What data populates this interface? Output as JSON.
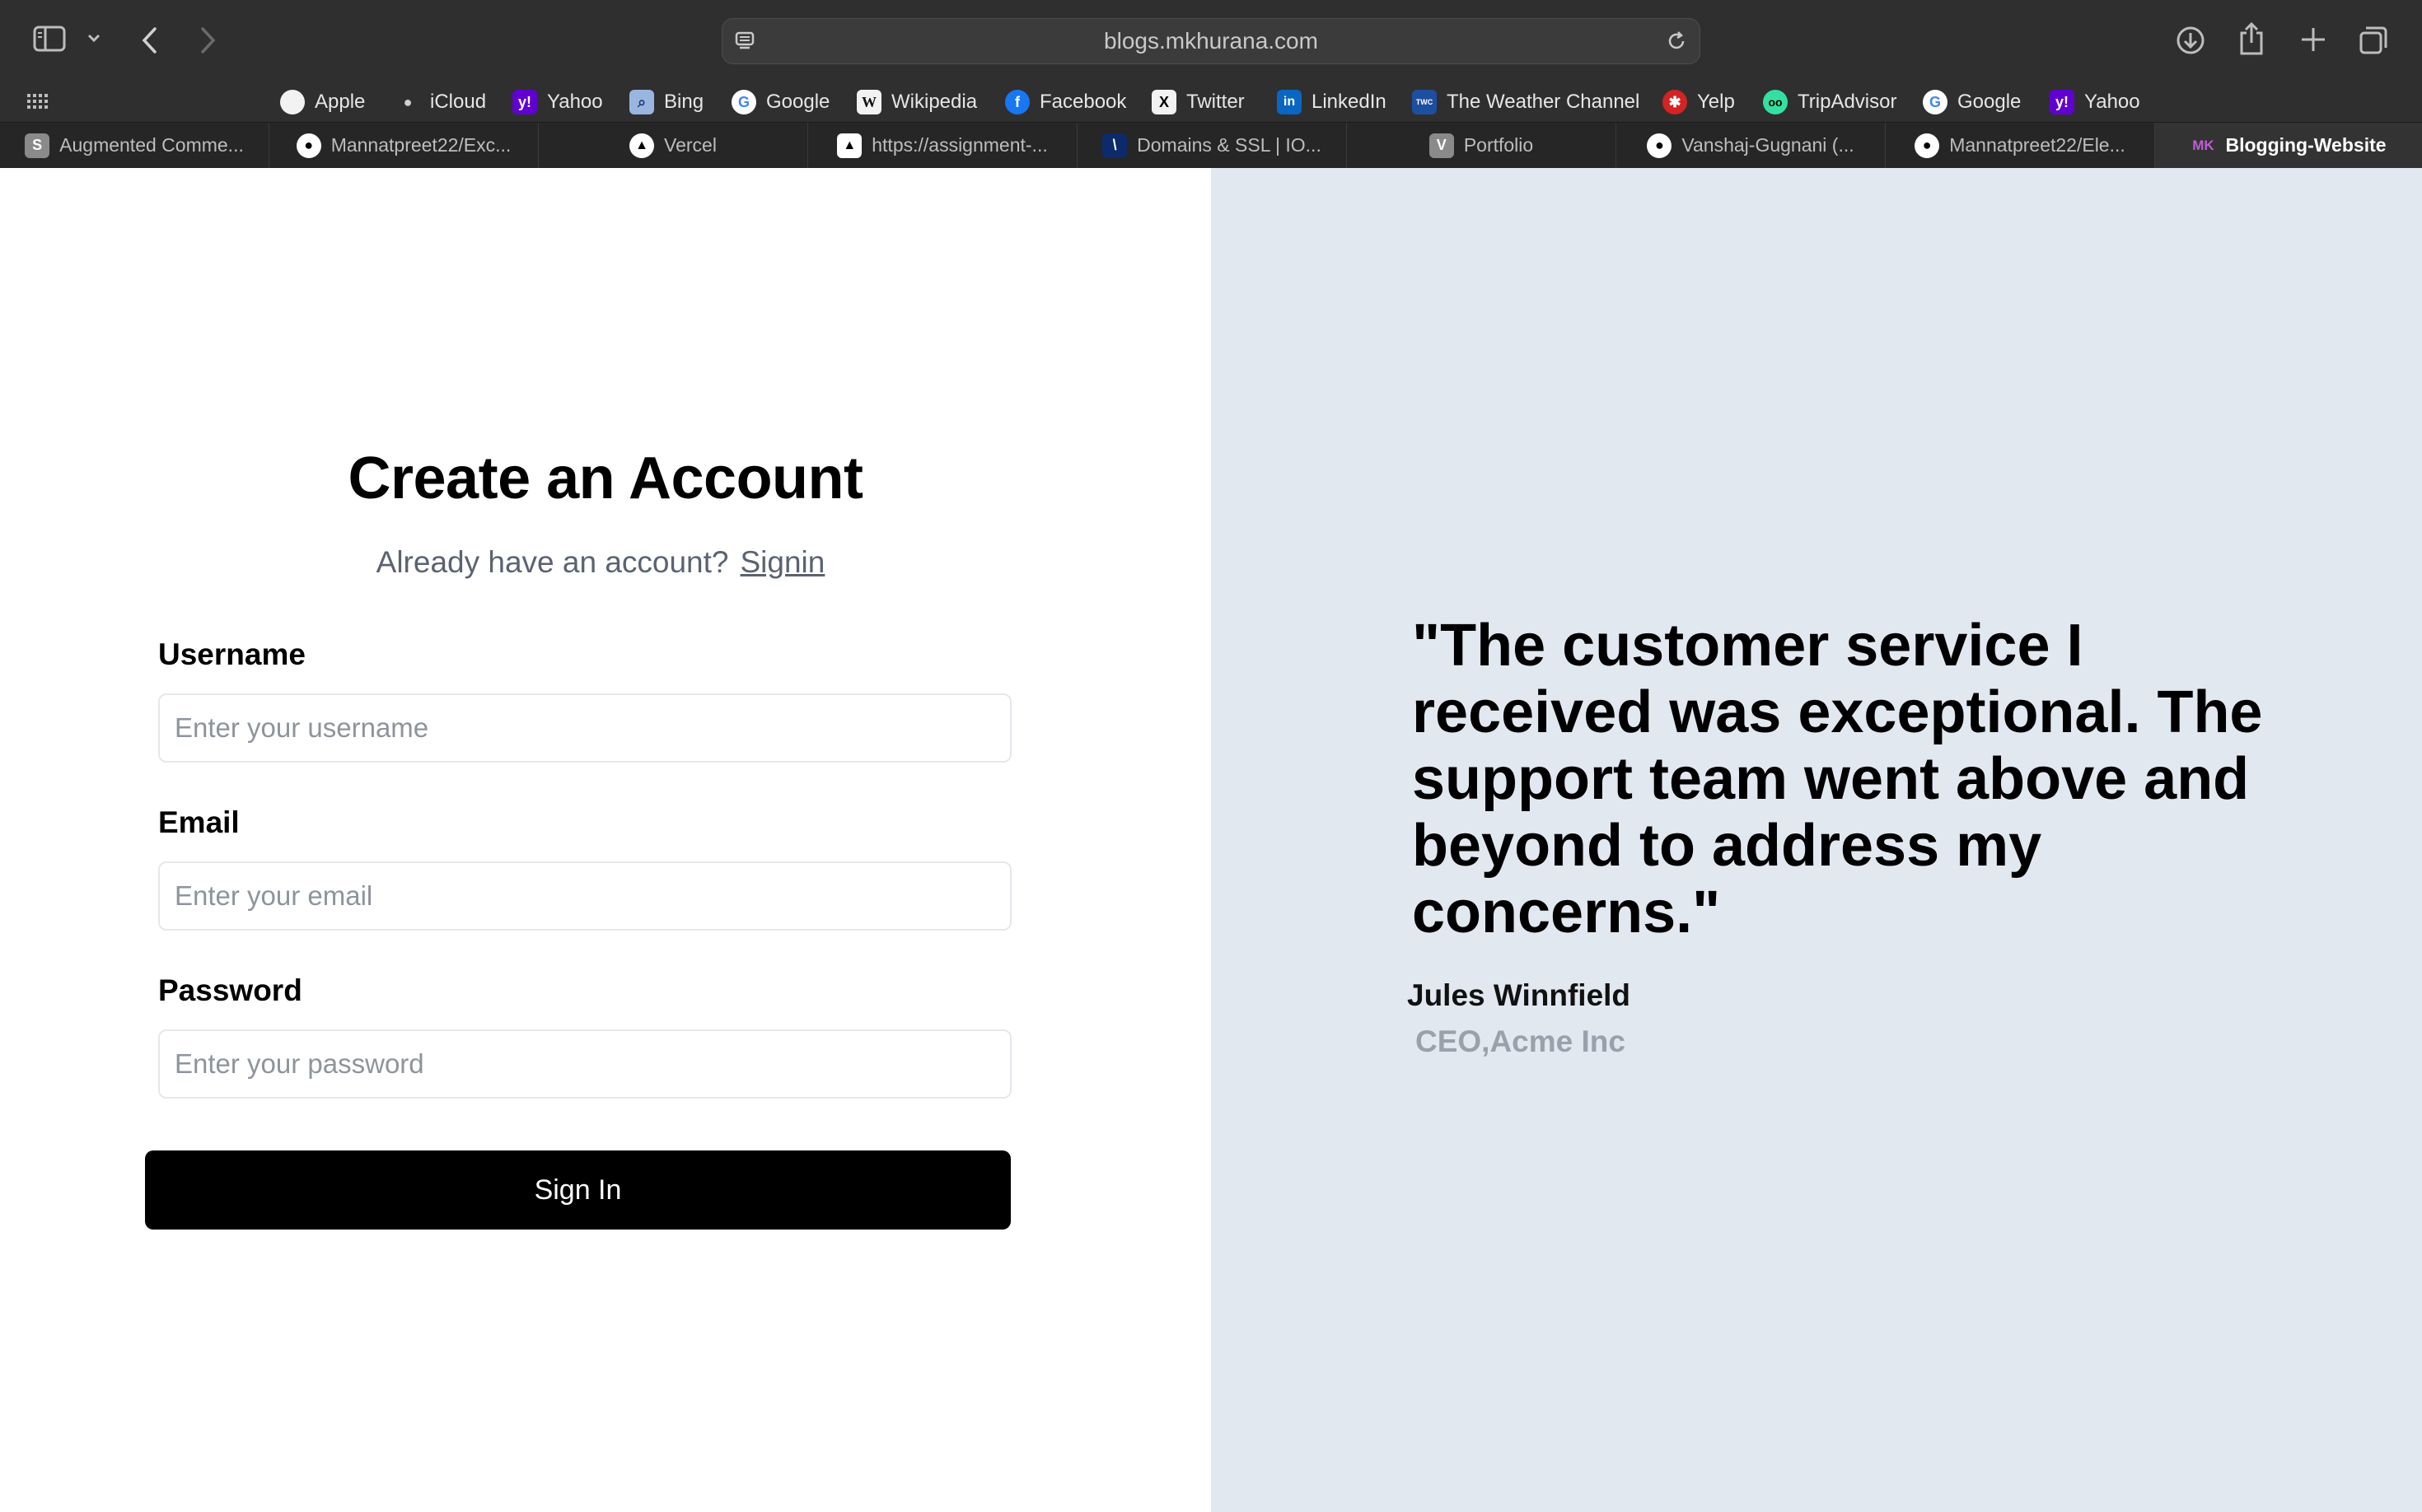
{
  "browser": {
    "url": "blogs.mkhurana.com",
    "favorites": [
      {
        "label": "Apple",
        "icon": "apple-icon"
      },
      {
        "label": "iCloud",
        "icon": "apple-icon"
      },
      {
        "label": "Yahoo",
        "icon": "yahoo-icon"
      },
      {
        "label": "Bing",
        "icon": "bing-icon"
      },
      {
        "label": "Google",
        "icon": "google-icon"
      },
      {
        "label": "Wikipedia",
        "icon": "wikipedia-icon"
      },
      {
        "label": "Facebook",
        "icon": "facebook-icon"
      },
      {
        "label": "Twitter",
        "icon": "x-icon"
      },
      {
        "label": "LinkedIn",
        "icon": "linkedin-icon"
      },
      {
        "label": "The Weather Channel",
        "icon": "weather-channel-icon"
      },
      {
        "label": "Yelp",
        "icon": "yelp-icon"
      },
      {
        "label": "TripAdvisor",
        "icon": "tripadvisor-icon"
      },
      {
        "label": "Google",
        "icon": "google-icon"
      },
      {
        "label": "Yahoo",
        "icon": "yahoo-icon"
      }
    ],
    "tabs": [
      {
        "label": "Augmented Comme...",
        "icon": "s-icon"
      },
      {
        "label": "Mannatpreet22/Exc...",
        "icon": "github-icon"
      },
      {
        "label": "Vercel",
        "icon": "vercel-icon"
      },
      {
        "label": "https://assignment-...",
        "icon": "vercel-icon"
      },
      {
        "label": "Domains & SSL | IO...",
        "icon": "slash-icon"
      },
      {
        "label": "Portfolio",
        "icon": "v-icon"
      },
      {
        "label": "Vanshaj-Gugnani (...",
        "icon": "github-icon"
      },
      {
        "label": "Mannatpreet22/Ele...",
        "icon": "github-icon"
      },
      {
        "label": "Blogging-Website",
        "icon": "mk-icon",
        "active": true
      }
    ]
  },
  "signup": {
    "title": "Create an Account",
    "prompt": "Already have an account?",
    "signin_link": "Signin",
    "username_label": "Username",
    "username_placeholder": "Enter your username",
    "email_label": "Email",
    "email_placeholder": "Enter your email",
    "password_label": "Password",
    "password_placeholder": "Enter your password",
    "submit_label": "Sign In"
  },
  "testimonial": {
    "quote": "\"The customer service I received was exceptional. The support team went above and beyond to address my concerns.\"",
    "author": "Jules Winnfield",
    "role": "CEO,Acme Inc"
  },
  "colors": {
    "chrome_bg": "#2f2f2f",
    "panel_bg": "#e2e8f0",
    "button_bg": "#000000",
    "muted_text": "#9aa1ac"
  }
}
